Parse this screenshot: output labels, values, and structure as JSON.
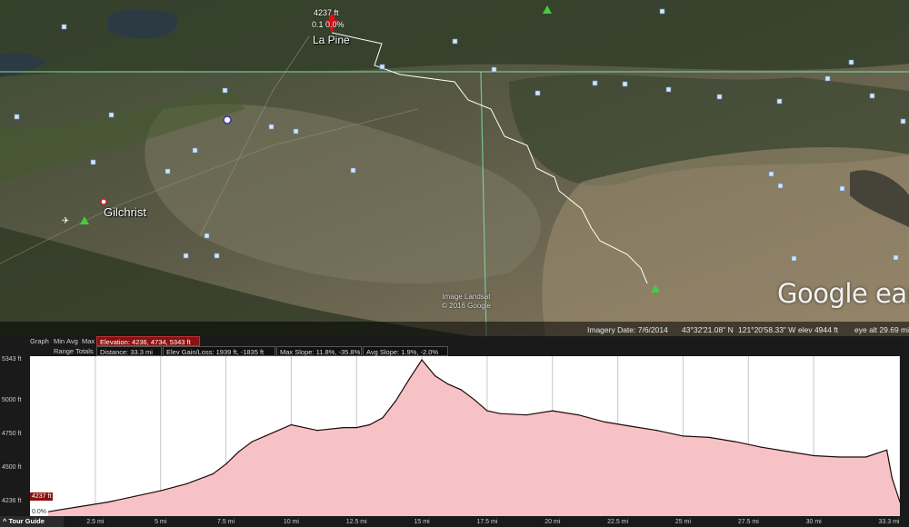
{
  "map": {
    "places": {
      "la_pine": "La Pine",
      "gilchrist": "Gilchrist"
    },
    "pin": {
      "elevation": "4237 ft",
      "slope": "0.1   0.0%"
    },
    "attribution": {
      "imagery": "Image Landsat",
      "copyright": "© 2016 Google"
    },
    "logo": "Google earth",
    "status": {
      "imagery_date": "Imagery Date: 7/6/2014",
      "lat": "43°32'21.08\" N",
      "lon": "121°20'58.33\" W",
      "elev": "elev  4944 ft",
      "eye_alt": "eye alt  29.69 mi"
    }
  },
  "profile": {
    "header": {
      "graph": "Graph",
      "min": "Min",
      "avg": "Avg",
      "max": "Max",
      "elevation": "Elevation: 4236, 4734, 5343 ft",
      "range_totals": "Range Totals",
      "distance": "Distance: 33.3 mi",
      "gain_loss": "Elev Gain/Loss: 1939 ft, -1835 ft",
      "max_slope": "Max Slope: 11.8%, -35.8%",
      "avg_slope": "Avg Slope: 1.9%, -2.0%"
    },
    "y_ticks": [
      "5343 ft",
      "5000 ft",
      "4750 ft",
      "4500 ft",
      "4236 ft"
    ],
    "x_ticks": [
      "2.5 mi",
      "5 mi",
      "7.5 mi",
      "10 mi",
      "12.5 mi",
      "15 mi",
      "17.5 mi",
      "20 mi",
      "22.5 mi",
      "25 mi",
      "27.5 mi",
      "30 mi",
      "33.3 mi"
    ],
    "cursor_elev": "4237 ft",
    "cursor_slope": "0.0%",
    "tour_guide": "Tour Guide"
  },
  "chart_data": {
    "type": "area",
    "xlabel": "",
    "ylabel": "",
    "x_unit": "mi",
    "y_unit": "ft",
    "xlim": [
      0,
      33.3
    ],
    "ylim": [
      4236,
      5343
    ],
    "x": [
      0,
      1,
      2,
      3,
      4,
      5,
      6,
      7,
      7.5,
      8,
      8.5,
      9,
      9.5,
      10,
      11,
      12,
      12.5,
      13,
      13.5,
      14,
      14.5,
      15,
      15.5,
      16,
      16.5,
      17,
      17.5,
      18,
      19,
      20,
      21,
      22,
      23,
      24,
      25,
      26,
      27,
      28,
      29,
      30,
      31,
      32,
      32.8,
      33,
      33.3
    ],
    "y": [
      4237,
      4270,
      4300,
      4330,
      4370,
      4410,
      4460,
      4530,
      4600,
      4690,
      4760,
      4800,
      4840,
      4880,
      4840,
      4860,
      4860,
      4880,
      4930,
      5050,
      5200,
      5343,
      5230,
      5170,
      5130,
      5060,
      4980,
      4960,
      4950,
      4980,
      4950,
      4900,
      4870,
      4840,
      4800,
      4790,
      4760,
      4720,
      4690,
      4660,
      4650,
      4650,
      4700,
      4500,
      4330
    ],
    "colors": {
      "line": "#1a0a0a",
      "fill": "#f7c2c6"
    }
  }
}
